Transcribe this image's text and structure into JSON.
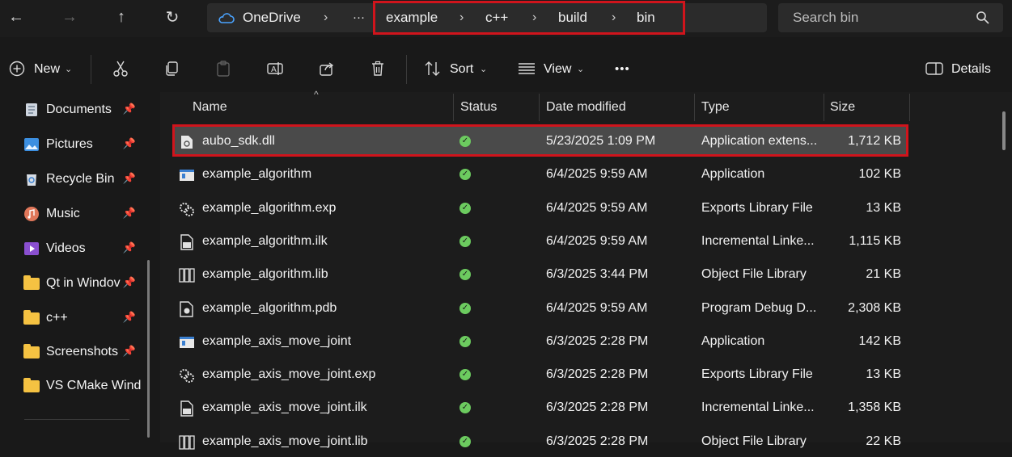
{
  "nav": {
    "back": "←",
    "forward": "→",
    "up": "↑",
    "refresh": "↻"
  },
  "address": {
    "root": "OneDrive",
    "overflow": "···",
    "crumbs": [
      "example",
      "c++",
      "build",
      "bin"
    ],
    "separator": "›"
  },
  "search": {
    "placeholder": "Search bin"
  },
  "toolbar": {
    "new_label": "New",
    "sort_label": "Sort",
    "view_label": "View",
    "more_label": "•••",
    "details_label": "Details"
  },
  "sidebar": {
    "items": [
      {
        "label": "Documents",
        "icon": "documents-icon"
      },
      {
        "label": "Pictures",
        "icon": "pictures-icon"
      },
      {
        "label": "Recycle Bin",
        "icon": "recycle-bin-icon"
      },
      {
        "label": "Music",
        "icon": "music-icon"
      },
      {
        "label": "Videos",
        "icon": "videos-icon"
      },
      {
        "label": "Qt in Windov",
        "icon": "folder-icon"
      },
      {
        "label": "c++",
        "icon": "folder-icon"
      },
      {
        "label": "Screenshots",
        "icon": "folder-icon"
      },
      {
        "label": "VS CMake Wind",
        "icon": "folder-icon"
      }
    ]
  },
  "columns": {
    "name": "Name",
    "status": "Status",
    "date": "Date modified",
    "type": "Type",
    "size": "Size"
  },
  "files": [
    {
      "name": "aubo_sdk.dll",
      "icon": "dll-icon",
      "date": "5/23/2025 1:09 PM",
      "type": "Application extens...",
      "size": "1,712 KB",
      "selected": true
    },
    {
      "name": "example_algorithm",
      "icon": "application-icon",
      "date": "6/4/2025 9:59 AM",
      "type": "Application",
      "size": "102 KB"
    },
    {
      "name": "example_algorithm.exp",
      "icon": "exports-file-icon",
      "date": "6/4/2025 9:59 AM",
      "type": "Exports Library File",
      "size": "13 KB"
    },
    {
      "name": "example_algorithm.ilk",
      "icon": "incremental-link-icon",
      "date": "6/4/2025 9:59 AM",
      "type": "Incremental Linke...",
      "size": "1,115 KB"
    },
    {
      "name": "example_algorithm.lib",
      "icon": "object-library-icon",
      "date": "6/3/2025 3:44 PM",
      "type": "Object File Library",
      "size": "21 KB"
    },
    {
      "name": "example_algorithm.pdb",
      "icon": "debug-database-icon",
      "date": "6/4/2025 9:59 AM",
      "type": "Program Debug D...",
      "size": "2,308 KB"
    },
    {
      "name": "example_axis_move_joint",
      "icon": "application-icon",
      "date": "6/3/2025 2:28 PM",
      "type": "Application",
      "size": "142 KB"
    },
    {
      "name": "example_axis_move_joint.exp",
      "icon": "exports-file-icon",
      "date": "6/3/2025 2:28 PM",
      "type": "Exports Library File",
      "size": "13 KB"
    },
    {
      "name": "example_axis_move_joint.ilk",
      "icon": "incremental-link-icon",
      "date": "6/3/2025 2:28 PM",
      "type": "Incremental Linke...",
      "size": "1,358 KB"
    },
    {
      "name": "example_axis_move_joint.lib",
      "icon": "object-library-icon",
      "date": "6/3/2025 2:28 PM",
      "type": "Object File Library",
      "size": "22 KB"
    }
  ],
  "colors": {
    "highlight": "#d0141c",
    "selected_row": "#4a4a4a",
    "status_ok": "#6ccb5f",
    "folder": "#f5c242"
  }
}
